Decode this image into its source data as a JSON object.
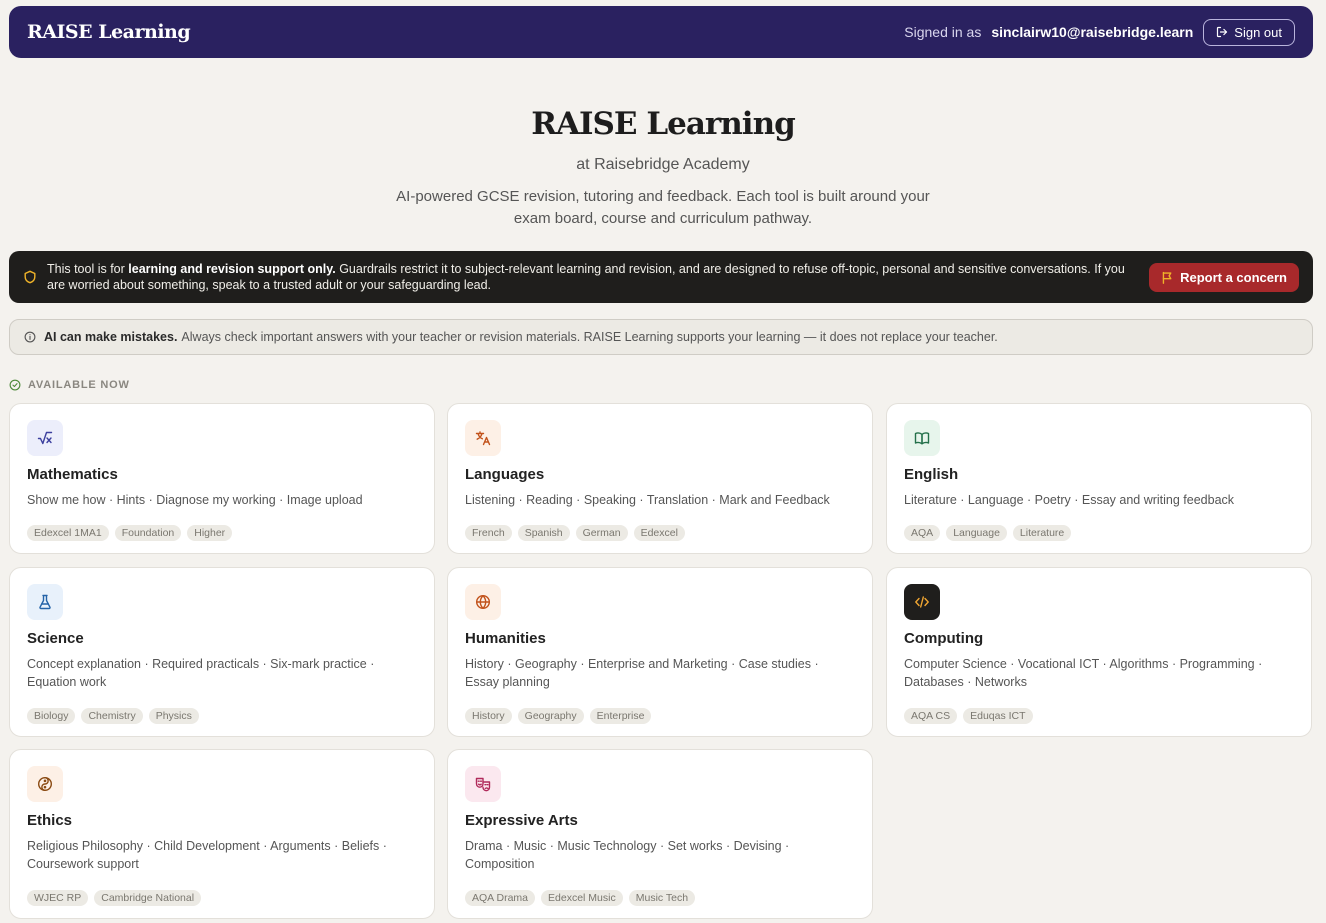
{
  "header": {
    "brand": "RAISE Learning",
    "signed_in_prefix": "Signed in as",
    "email": "sinclairw10@raisebridge.learn",
    "signout_label": "Sign out"
  },
  "hero": {
    "title": "RAISE Learning",
    "subtitle": "at Raisebridge Academy",
    "description": "AI-powered GCSE revision, tutoring and feedback. Each tool is built around your exam board, course and curriculum pathway."
  },
  "safeguarding": {
    "text_pre": "This tool is for ",
    "text_bold": "learning and revision support only.",
    "text_post": " Guardrails restrict it to subject-relevant learning and revision, and are designed to refuse off-topic, personal and sensitive conversations. If you are worried about something, speak to a trusted adult or your safeguarding lead.",
    "button_label": "Report a concern"
  },
  "disclaimer": {
    "bold": "AI can make mistakes.",
    "text": "Always check important answers with your teacher or revision materials. RAISE Learning supports your learning — it does not replace your teacher."
  },
  "section_label": "AVAILABLE NOW",
  "subjects": [
    {
      "title": "Mathematics",
      "features": "Show me how · Hints · Diagnose my working · Image upload",
      "tags": [
        "Edexcel 1MA1",
        "Foundation",
        "Higher"
      ],
      "icon": "square-root-icon",
      "icon_bg": "#eceefb",
      "icon_color": "#3b3f9e"
    },
    {
      "title": "Languages",
      "features": "Listening · Reading · Speaking · Translation · Mark and Feedback",
      "tags": [
        "French",
        "Spanish",
        "German",
        "Edexcel"
      ],
      "icon": "translate-icon",
      "icon_bg": "#fdf0e6",
      "icon_color": "#c2521b"
    },
    {
      "title": "English",
      "features": "Literature · Language · Poetry · Essay and writing feedback",
      "tags": [
        "AQA",
        "Language",
        "Literature"
      ],
      "icon": "book-open-icon",
      "icon_bg": "#e7f5ec",
      "icon_color": "#24704a"
    },
    {
      "title": "Science",
      "features": "Concept explanation · Required practicals · Six-mark practice · Equation work",
      "tags": [
        "Biology",
        "Chemistry",
        "Physics"
      ],
      "icon": "flask-icon",
      "icon_bg": "#e8f1fb",
      "icon_color": "#2463a8"
    },
    {
      "title": "Humanities",
      "features": "History · Geography · Enterprise and Marketing · Case studies · Essay planning",
      "tags": [
        "History",
        "Geography",
        "Enterprise"
      ],
      "icon": "globe-icon",
      "icon_bg": "#fdf0e6",
      "icon_color": "#c2521b"
    },
    {
      "title": "Computing",
      "features": "Computer Science · Vocational ICT · Algorithms · Programming · Databases · Networks",
      "tags": [
        "AQA CS",
        "Eduqas ICT"
      ],
      "icon": "code-icon",
      "icon_bg": "#1f1e1c",
      "icon_color": "#f0a632"
    },
    {
      "title": "Ethics",
      "features": "Religious Philosophy · Child Development · Arguments · Beliefs · Coursework support",
      "tags": [
        "WJEC RP",
        "Cambridge National"
      ],
      "icon": "yin-yang-icon",
      "icon_bg": "#fdf0e6",
      "icon_color": "#8a4a12"
    },
    {
      "title": "Expressive Arts",
      "features": "Drama · Music · Music Technology · Set works · Devising · Composition",
      "tags": [
        "AQA Drama",
        "Edexcel Music",
        "Music Tech"
      ],
      "icon": "theater-masks-icon",
      "icon_bg": "#fbe8ef",
      "icon_color": "#b02a5b"
    }
  ]
}
